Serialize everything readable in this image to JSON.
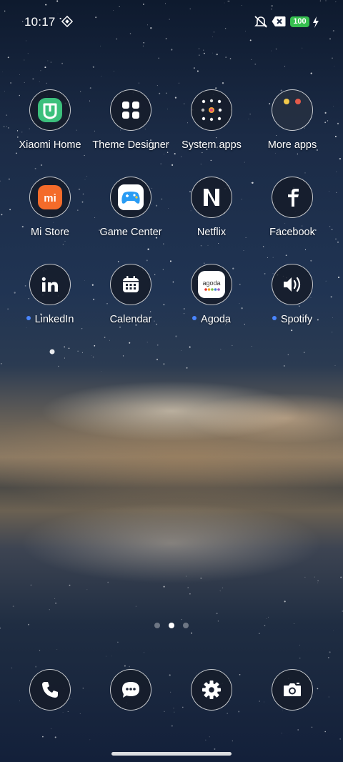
{
  "status_bar": {
    "time": "10:17",
    "battery": "100",
    "battery_color": "#36c04f",
    "icons": [
      "vpn-icon",
      "mute-icon",
      "close-box-icon",
      "charging-icon"
    ]
  },
  "apps": [
    {
      "label": "Xiaomi Home",
      "icon": "xiaomi-home-icon",
      "badge": false
    },
    {
      "label": "Theme Designer",
      "icon": "grid-icon",
      "badge": false
    },
    {
      "label": "System apps",
      "icon": "folder-icon",
      "badge": false
    },
    {
      "label": "More apps",
      "icon": "folder-icon",
      "badge": false
    },
    {
      "label": "Mi Store",
      "icon": "mi-store-icon",
      "badge": false
    },
    {
      "label": "Game Center",
      "icon": "gamepad-icon",
      "badge": false
    },
    {
      "label": "Netflix",
      "icon": "netflix-icon",
      "badge": false
    },
    {
      "label": "Facebook",
      "icon": "facebook-icon",
      "badge": false
    },
    {
      "label": "LinkedIn",
      "icon": "linkedin-icon",
      "badge": true
    },
    {
      "label": "Calendar",
      "icon": "calendar-icon",
      "badge": false
    },
    {
      "label": "Agoda",
      "icon": "agoda-icon",
      "badge": true
    },
    {
      "label": "Spotify",
      "icon": "speaker-icon",
      "badge": true
    }
  ],
  "agoda_wordmark": "agoda",
  "mi_store_mark": "mi",
  "page_indicator": {
    "count": 3,
    "active": 2
  },
  "dock": [
    "phone-icon",
    "messages-icon",
    "settings-icon",
    "camera-icon"
  ],
  "colors": {
    "notification_dot": "#4a86ff",
    "xiaomi_home_green": "#3cc07c",
    "mi_orange": "#f46b2a"
  }
}
